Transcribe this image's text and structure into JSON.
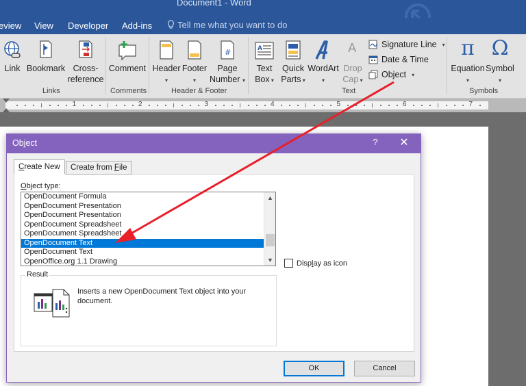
{
  "window": {
    "title": "Document1  -  Word"
  },
  "ribbon_tabs": [
    "eview",
    "View",
    "Developer",
    "Add-ins"
  ],
  "tell_me": "Tell me what you want to do",
  "ribbon": {
    "links_group": {
      "label": "Links",
      "link": "Link",
      "bookmark": "Bookmark",
      "cross_reference_1": "Cross-",
      "cross_reference_2": "reference"
    },
    "comments_group": {
      "label": "Comments",
      "comment": "Comment"
    },
    "header_footer_group": {
      "label": "Header & Footer",
      "header": "Header",
      "footer": "Footer",
      "page_number_1": "Page",
      "page_number_2": "Number"
    },
    "text_group": {
      "label": "Text",
      "text_box_1": "Text",
      "text_box_2": "Box",
      "quick_parts_1": "Quick",
      "quick_parts_2": "Parts",
      "wordart": "WordArt",
      "drop_cap_1": "Drop",
      "drop_cap_2": "Cap",
      "signature_line": "Signature Line",
      "date_time": "Date & Time",
      "object": "Object"
    },
    "symbols_group": {
      "label": "Symbols",
      "equation": "Equation",
      "symbol": "Symbol",
      "equation_glyph": "π",
      "symbol_glyph": "Ω"
    }
  },
  "ruler_numbers": [
    "1",
    "2",
    "3",
    "4",
    "5",
    "6",
    "7"
  ],
  "dialog": {
    "title": "Object",
    "help": "?",
    "close": "✕",
    "tabs": {
      "create_new_pre": "",
      "create_new_u": "C",
      "create_new_post": "reate New",
      "create_from_file_pre": "Create from ",
      "create_from_file_u": "F",
      "create_from_file_post": "ile"
    },
    "object_type_label_u": "O",
    "object_type_label_post": "bject type:",
    "object_types": [
      "OpenDocument Formula",
      "OpenDocument Presentation",
      "OpenDocument Presentation",
      "OpenDocument Spreadsheet",
      "OpenDocument Spreadsheet",
      "OpenDocument Text",
      "OpenDocument Text",
      "OpenOffice.org 1.1 Drawing"
    ],
    "selected_index": 5,
    "display_as_icon_pre": "Disp",
    "display_as_icon_u": "l",
    "display_as_icon_post": "ay as icon",
    "display_as_icon_checked": false,
    "result_label": "Result",
    "result_text": "Inserts a new OpenDocument Text object into your document.",
    "ok": "OK",
    "cancel": "Cancel"
  },
  "colors": {
    "word_blue": "#2b579a",
    "dialog_purple": "#8463be",
    "selection_blue": "#0078d7",
    "annotation_red": "#e8202a"
  }
}
